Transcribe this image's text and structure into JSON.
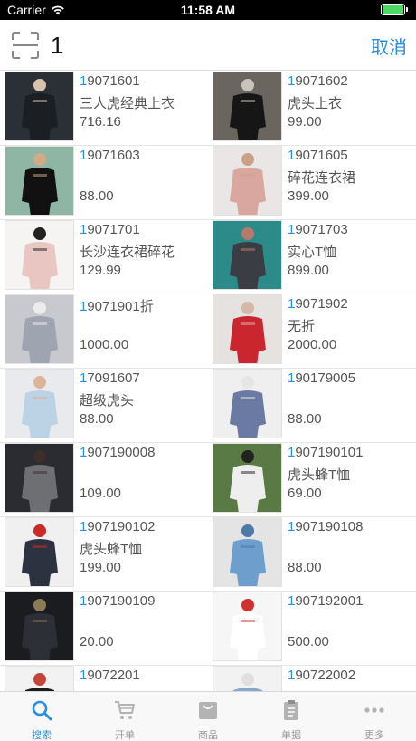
{
  "status": {
    "carrier": "Carrier",
    "time": "11:58 AM"
  },
  "search": {
    "value": "1",
    "cancel": "取消"
  },
  "products": [
    {
      "code": "19071601",
      "name": "三人虎经典上衣",
      "price": "716.16",
      "img": {
        "bg": "#2b2f36",
        "fg": "#1b1e23",
        "accent": "#d8c2ae"
      }
    },
    {
      "code": "19071602",
      "name": "虎头上衣",
      "price": "99.00",
      "img": {
        "bg": "#6b6560",
        "fg": "#161616",
        "accent": "#c9c3bc"
      }
    },
    {
      "code": "19071603",
      "name": "",
      "price": "88.00",
      "img": {
        "bg": "#8fb6a4",
        "fg": "#111111",
        "accent": "#d2a989"
      }
    },
    {
      "code": "19071605",
      "name": "碎花连衣裙",
      "price": "399.00",
      "img": {
        "bg": "#e9e6e5",
        "fg": "#d9a6a0",
        "accent": "#caa088"
      }
    },
    {
      "code": "19071701",
      "name": "长沙连衣裙碎花",
      "price": "129.99",
      "img": {
        "bg": "#f5f4f2",
        "fg": "#e9c6c2",
        "accent": "#222222"
      }
    },
    {
      "code": "19071703",
      "name": "实心T恤",
      "price": "899.00",
      "img": {
        "bg": "#2c8b88",
        "fg": "#3a3e44",
        "accent": "#b77b6c"
      }
    },
    {
      "code": "19071901折",
      "name": "",
      "price": "1000.00",
      "img": {
        "bg": "#c7c9cf",
        "fg": "#9ea4b0",
        "accent": "#ececec"
      }
    },
    {
      "code": "19071902",
      "name": "无折",
      "price": "2000.00",
      "img": {
        "bg": "#e5e2df",
        "fg": "#c9262f",
        "accent": "#d4b8a8"
      }
    },
    {
      "code": "17091607",
      "name": "超级虎头",
      "price": "88.00",
      "img": {
        "bg": "#e8eaee",
        "fg": "#bcd3e6",
        "accent": "#dcb49a"
      }
    },
    {
      "code": "190179005",
      "name": "",
      "price": "88.00",
      "img": {
        "bg": "#efefef",
        "fg": "#6b7aa3",
        "accent": "#e6e6e6"
      }
    },
    {
      "code": "1907190008",
      "name": "",
      "price": "109.00",
      "img": {
        "bg": "#2a2c31",
        "fg": "#6e6f72",
        "accent": "#3d2f2a"
      }
    },
    {
      "code": "1907190101",
      "name": "虎头蜂T恤",
      "price": "69.00",
      "img": {
        "bg": "#5a7a45",
        "fg": "#eeeeee",
        "accent": "#222222"
      }
    },
    {
      "code": "1907190102",
      "name": "虎头蜂T恤",
      "price": "199.00",
      "img": {
        "bg": "#f0f0f0",
        "fg": "#2c3240",
        "accent": "#c92a2a"
      }
    },
    {
      "code": "1907190108",
      "name": "",
      "price": "88.00",
      "img": {
        "bg": "#e4e4e4",
        "fg": "#6e9ecb",
        "accent": "#4e78a8"
      }
    },
    {
      "code": "1907190109",
      "name": "",
      "price": "20.00",
      "img": {
        "bg": "#1b1c20",
        "fg": "#2c2f36",
        "accent": "#8a7a55"
      }
    },
    {
      "code": "1907192001",
      "name": "",
      "price": "500.00",
      "img": {
        "bg": "#f6f6f6",
        "fg": "#ffffff",
        "accent": "#d0312d"
      }
    },
    {
      "code": "19072201",
      "name": "",
      "price": "",
      "img": {
        "bg": "#f2f2f2",
        "fg": "#1c1c1c",
        "accent": "#c4453c"
      }
    },
    {
      "code": "190722002",
      "name": "",
      "price": "",
      "img": {
        "bg": "#f2f2f2",
        "fg": "#8aa6c8",
        "accent": "#e0e0e0"
      }
    }
  ],
  "tabs": [
    {
      "label": "搜索",
      "icon": "search-icon",
      "active": true
    },
    {
      "label": "开单",
      "icon": "cart-icon",
      "active": false
    },
    {
      "label": "商品",
      "icon": "bag-icon",
      "active": false
    },
    {
      "label": "单据",
      "icon": "clipboard-icon",
      "active": false
    },
    {
      "label": "更多",
      "icon": "more-icon",
      "active": false
    }
  ],
  "colors": {
    "accent": "#2b8ee0",
    "battery": "#4cd964"
  }
}
